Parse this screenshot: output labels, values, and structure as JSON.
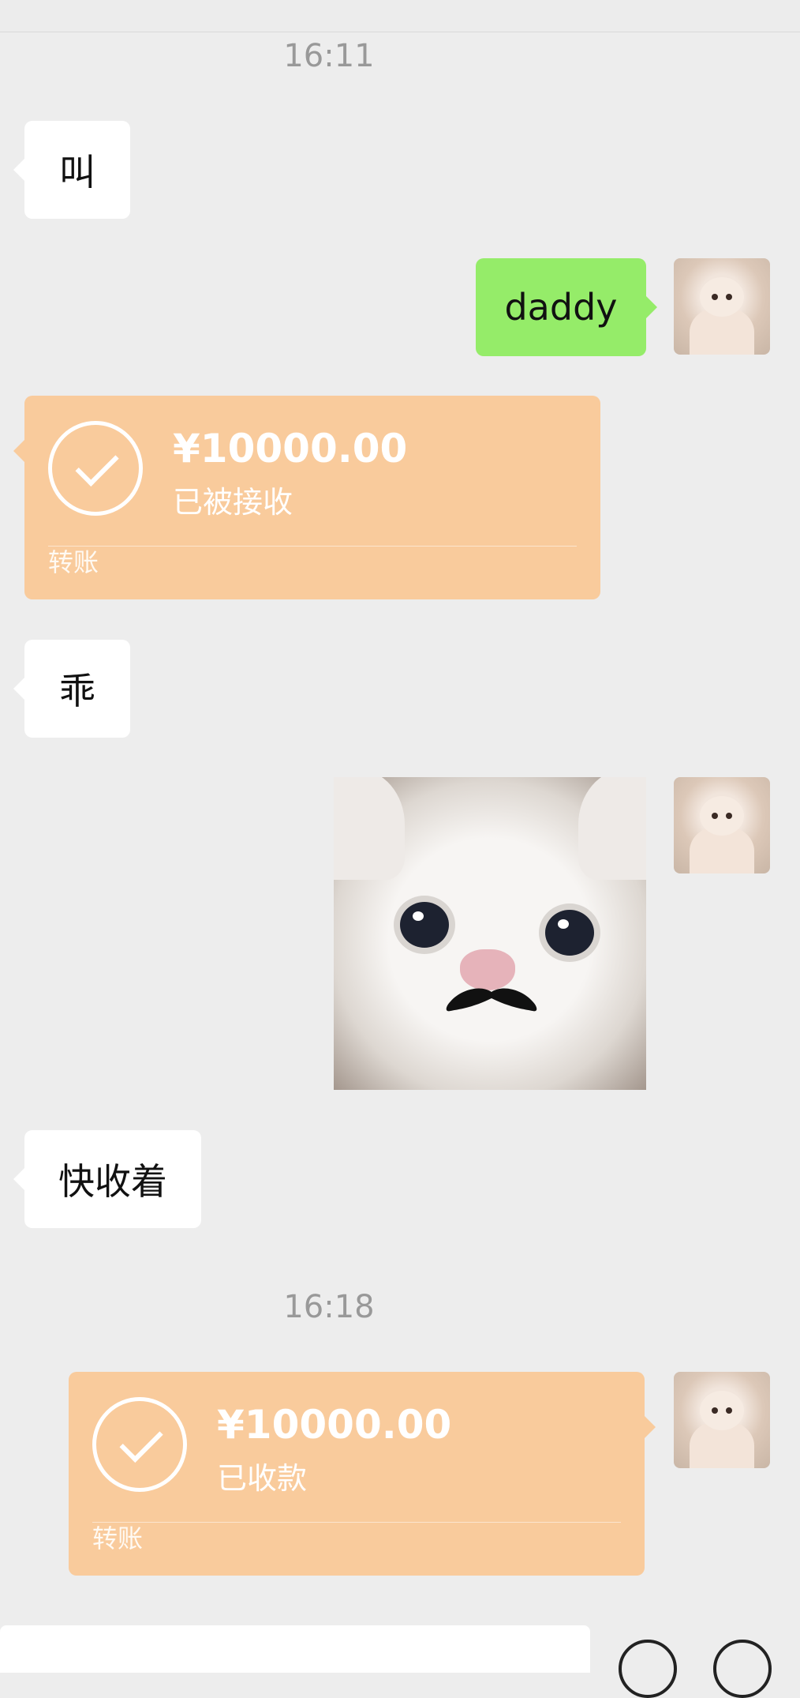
{
  "messages": {
    "time1": "16:11",
    "m1": "叫",
    "m2": "daddy",
    "t1_amount": "¥10000.00",
    "t1_status": "已被接收",
    "t1_label": "转账",
    "m3": "乖",
    "m4": "快收着",
    "time2": "16:18",
    "t2_amount": "¥10000.00",
    "t2_status": "已收款",
    "t2_label": "转账"
  },
  "colors": {
    "background": "#ededed",
    "sent_bubble": "#95ec69",
    "transfer": "#f9cb9c"
  },
  "icons": [
    "check-circle-icon",
    "emoji-icon",
    "plus-icon"
  ]
}
